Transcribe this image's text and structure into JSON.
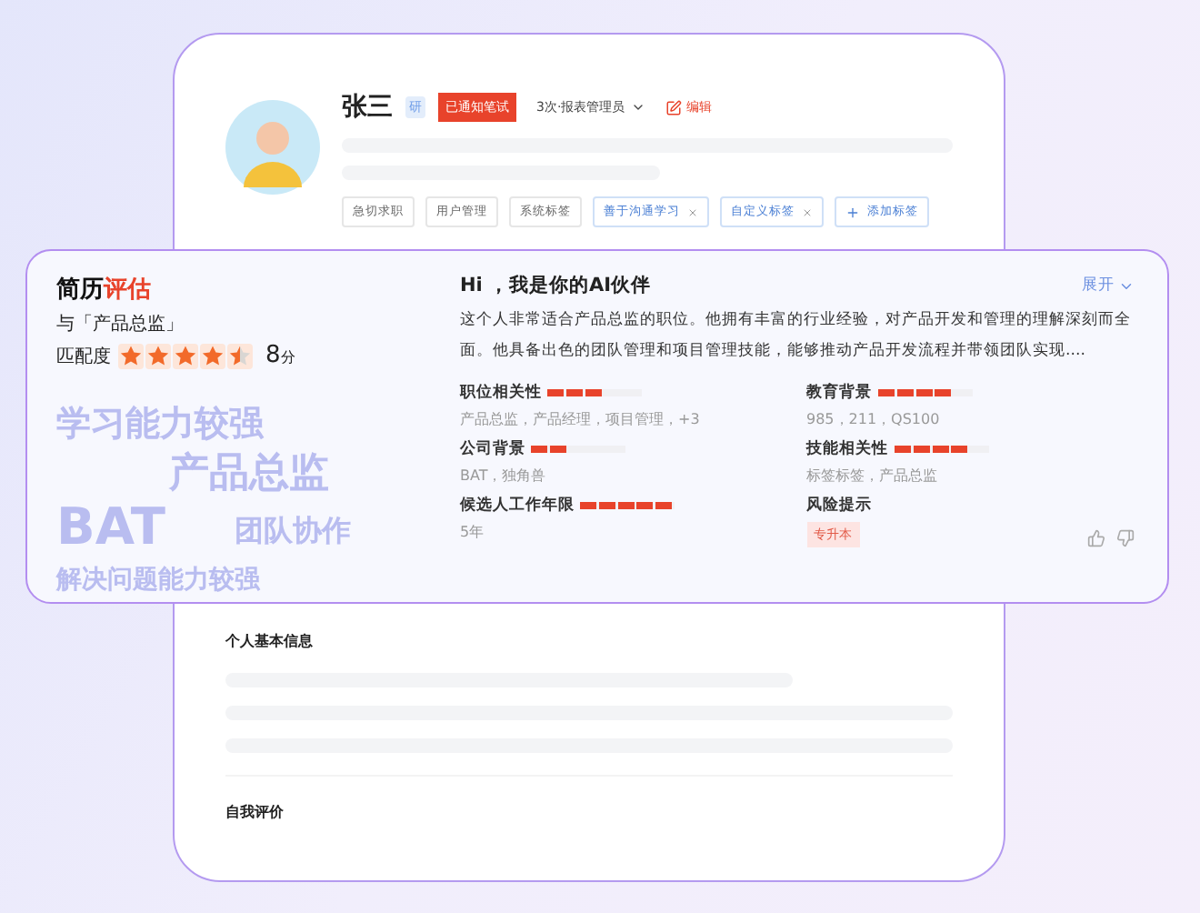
{
  "profile": {
    "name": "张三",
    "badge": "研",
    "status": "已通知笔试",
    "stage": "3次·报表管理员",
    "edit": "编辑",
    "tags": [
      {
        "label": "急切求职",
        "kind": "plain"
      },
      {
        "label": "用户管理",
        "kind": "plain"
      },
      {
        "label": "系统标签",
        "kind": "plain"
      },
      {
        "label": "善于沟通学习",
        "kind": "custom"
      },
      {
        "label": "自定义标签",
        "kind": "custom"
      },
      {
        "label": "添加标签",
        "kind": "add"
      }
    ]
  },
  "evaluation": {
    "title": "简历",
    "title_highlight": "评估",
    "target": "与「产品总监」",
    "match_label": "匹配度",
    "stars": 4.5,
    "score": "8",
    "score_unit": "分",
    "keywords": [
      "学习能力较强",
      "产品总监",
      "BAT",
      "团队协作",
      "解决问题能力较强"
    ],
    "greeting": "Hi ，我是你的AI伙伴",
    "expand": "展开",
    "summary": "这个人非常适合产品总监的职位。他拥有丰富的行业经验，对产品开发和管理的理解深刻而全面。他具备出色的团队管理和项目管理技能，能够推动产品开发流程并带领团队实现....",
    "criteria": [
      {
        "kind": "bar",
        "label": "职位相关性",
        "level": 0.6,
        "detail": "产品总监，产品经理，项目管理，+3"
      },
      {
        "kind": "bar",
        "label": "教育背景",
        "level": 0.8,
        "detail": "985，211，QS100"
      },
      {
        "kind": "bar",
        "label": "公司背景",
        "level": 0.4,
        "detail": "BAT，独角兽"
      },
      {
        "kind": "bar",
        "label": "技能相关性",
        "level": 0.8,
        "detail": "标签标签，产品总监"
      },
      {
        "kind": "bar",
        "label": "候选人工作年限",
        "level": 1,
        "detail": "5年"
      },
      {
        "kind": "tag",
        "label": "风险提示",
        "detail": "专升本"
      }
    ]
  },
  "sections": [
    {
      "title": "个人基本信息"
    },
    {
      "title": "自我评价"
    }
  ]
}
